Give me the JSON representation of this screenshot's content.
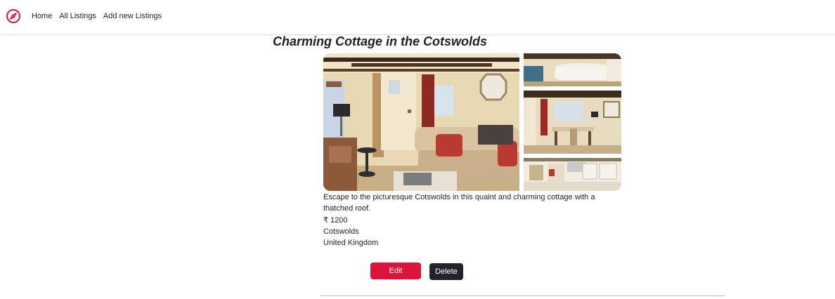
{
  "nav": {
    "brand_icon": "compass-icon",
    "links": [
      "Home",
      "All Listings",
      "Add new Listings"
    ]
  },
  "listing": {
    "title": "Charming Cottage in the Cotswolds",
    "description": "Escape to the picturesque Cotswolds in this quaint and charming cottage with a thatched roof.",
    "price": "₹ 1200",
    "location": "Cotswolds",
    "country": "United Kingdom",
    "photos": [
      "living-room-photo",
      "bathroom-photo",
      "dining-room-photo",
      "kitchen-photo"
    ]
  },
  "actions": {
    "edit_label": "Edit",
    "delete_label": "Delete"
  },
  "colors": {
    "accent": "#dc143c",
    "dark_button": "#212529"
  }
}
